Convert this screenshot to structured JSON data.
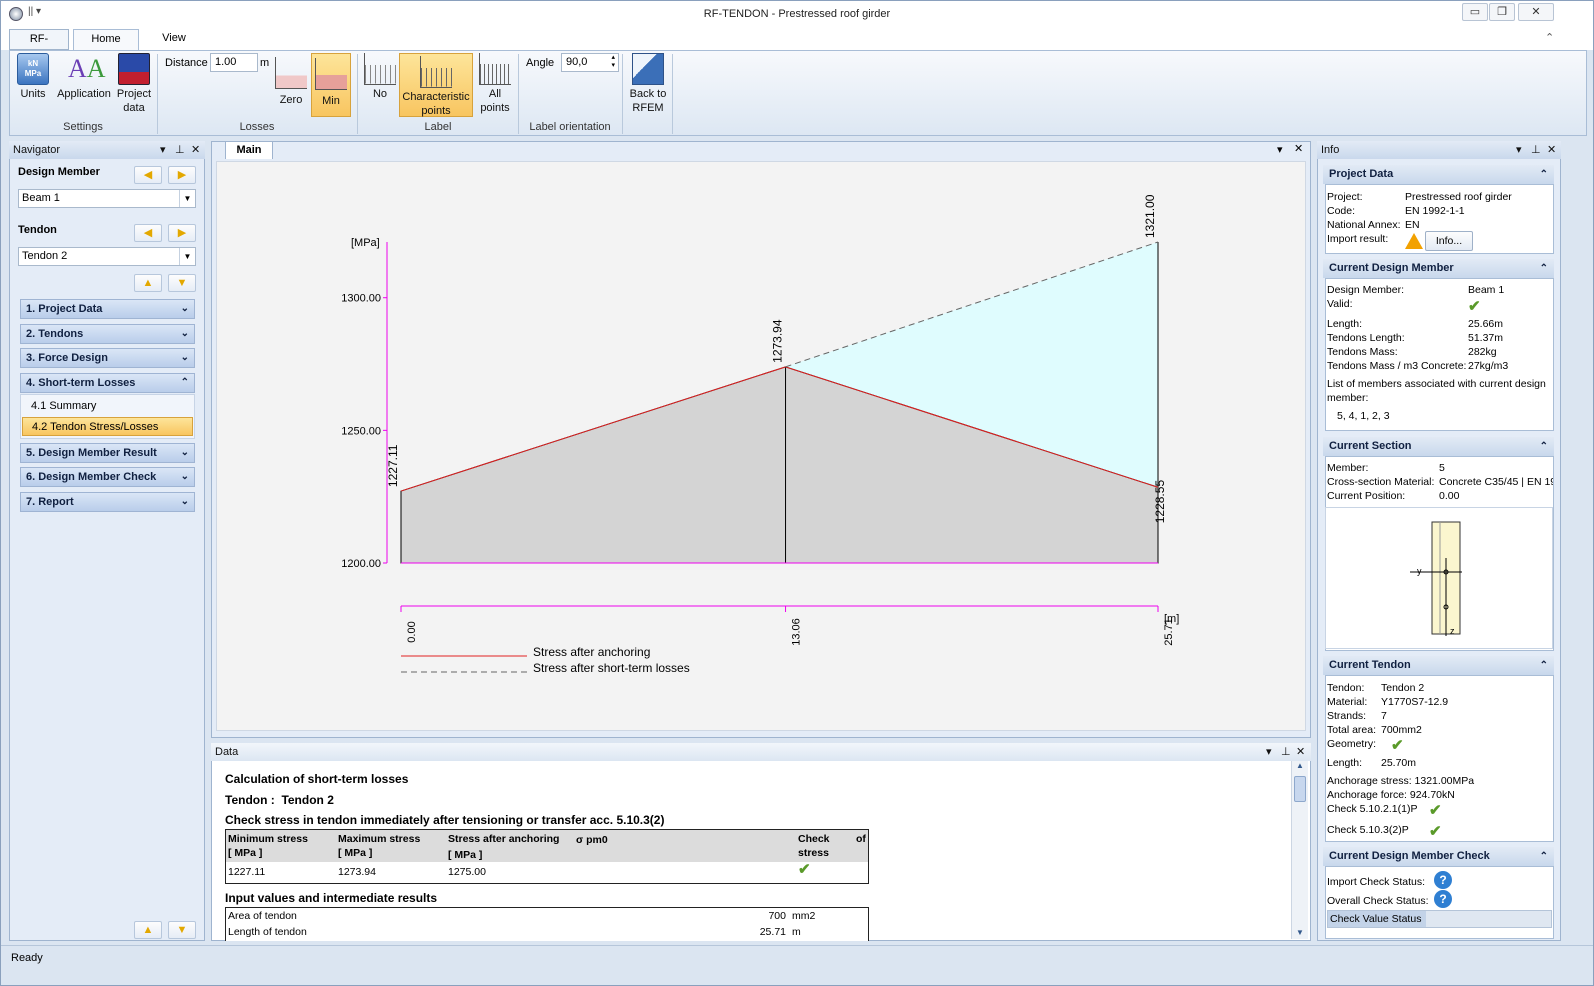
{
  "window": {
    "title": "RF-TENDON - Prestressed roof girder"
  },
  "tabs": {
    "app": "RF-TENDON",
    "home": "Home",
    "view": "View"
  },
  "ribbon": {
    "units": "Units",
    "application": "Application",
    "project_data_l1": "Project",
    "project_data_l2": "data",
    "settings_group": "Settings",
    "distance_label": "Distance",
    "distance_value": "1.00",
    "distance_unit": "m",
    "zero": "Zero",
    "min": "Min",
    "losses_group": "Losses",
    "no": "No",
    "characteristic_l1": "Characteristic",
    "characteristic_l2": "points",
    "all_l1": "All",
    "all_l2": "points",
    "label_group": "Label",
    "angle_label": "Angle",
    "angle_value": "90,0",
    "label_orientation_group": "Label orientation",
    "back_l1": "Back to",
    "back_l2": "RFEM"
  },
  "navigator": {
    "title": "Navigator",
    "design_member_label": "Design Member",
    "design_member_value": "Beam 1",
    "tendon_label": "Tendon",
    "tendon_value": "Tendon 2",
    "sections": [
      "1. Project Data",
      "2. Tendons",
      "3. Force Design",
      "4. Short-term Losses",
      "5. Design Member Result",
      "6. Design Member Check",
      "7. Report"
    ],
    "subitems": [
      "4.1 Summary",
      "4.2 Tendon Stress/Losses"
    ]
  },
  "main_tab": "Main",
  "chart_data": {
    "type": "area",
    "ylabel": "[MPa]",
    "xlabel": "[m]",
    "ylim": [
      1200,
      1321
    ],
    "yticks": [
      "1300.00",
      "1250.00",
      "1200.00"
    ],
    "xticks": [
      "0.00",
      "13.06",
      "25.71"
    ],
    "series": [
      {
        "name": "Stress after anchoring",
        "color": "#e02020",
        "x": [
          0.0,
          13.06,
          25.71
        ],
        "y": [
          1227.11,
          1273.94,
          1228.55
        ]
      },
      {
        "name": "Stress after short-term losses",
        "color": "#666666",
        "x": [
          13.06,
          25.71
        ],
        "y": [
          1273.94,
          1321.0
        ]
      }
    ],
    "labels": [
      "1227.11",
      "1273.94",
      "1321.00",
      "1228.55"
    ]
  },
  "data_panel": {
    "title": "Data",
    "heading": "Calculation of short-term losses",
    "tendon_label": "Tendon :",
    "tendon_value": "Tendon 2",
    "check_heading": "Check stress in tendon immediately after tensioning or transfer acc. 5.10.3(2)",
    "cols": [
      "Minimum stress",
      "Maximum stress",
      "Stress after anchoring",
      "Check",
      "of"
    ],
    "sigma": "σ pm0",
    "col2": [
      "[ MPa ]",
      "[ MPa ]",
      "[ MPa ]",
      "stress"
    ],
    "row": [
      "1227.11",
      "1273.94",
      "1275.00"
    ],
    "input_heading": "Input values and intermediate results",
    "inputs": [
      {
        "label": "Area of tendon",
        "value": "700",
        "unit": "mm2"
      },
      {
        "label": "Length of tendon",
        "value": "25.71",
        "unit": "m"
      }
    ]
  },
  "info": {
    "title": "Info",
    "project_data": {
      "title": "Project Data",
      "project_k": "Project:",
      "project_v": "Prestressed roof girder",
      "code_k": "Code:",
      "code_v": "EN 1992-1-1",
      "annex_k": "National Annex:",
      "annex_v": "EN",
      "import_k": "Import result:",
      "info_btn": "Info..."
    },
    "design_member": {
      "title": "Current Design Member",
      "dm_k": "Design Member:",
      "dm_v": "Beam 1",
      "valid_k": "Valid:",
      "len_k": "Length:",
      "len_v": "25.66m",
      "tlen_k": "Tendons Length:",
      "tlen_v": "51.37m",
      "tmass_k": "Tendons Mass:",
      "tmass_v": "282kg",
      "tm3_k": "Tendons Mass / m3 Concrete:",
      "tm3_v": "27kg/m3",
      "list_l1": "List of members associated with current design",
      "list_l2": "member:",
      "list_v": "5, 4, 1, 2, 3"
    },
    "section": {
      "title": "Current Section",
      "member_k": "Member:",
      "member_v": "5",
      "mat_k": "Cross-section Material:",
      "mat_v": "Concrete C35/45 | EN 19",
      "pos_k": "Current Position:",
      "pos_v": "0.00",
      "y": "y",
      "z": "z"
    },
    "tendon": {
      "title": "Current Tendon",
      "tendon_k": "Tendon:",
      "tendon_v": "Tendon 2",
      "mat_k": "Material:",
      "mat_v": "Y1770S7-12.9",
      "strands_k": "Strands:",
      "strands_v": "7",
      "area_k": "Total area:",
      "area_v": "700mm2",
      "geom_k": "Geometry:",
      "len_k": "Length:",
      "len_v": "25.70m",
      "anch_s": "Anchorage stress: 1321.00MPa",
      "anch_f": "Anchorage force:  924.70kN",
      "c1": "Check 5.10.2.1(1)P",
      "c2": "Check 5.10.3(2)P"
    },
    "check": {
      "title": "Current Design Member Check",
      "import_k": "Import Check Status:",
      "overall_k": "Overall Check Status:",
      "value_k": "Check Value Status"
    }
  },
  "status": "Ready"
}
